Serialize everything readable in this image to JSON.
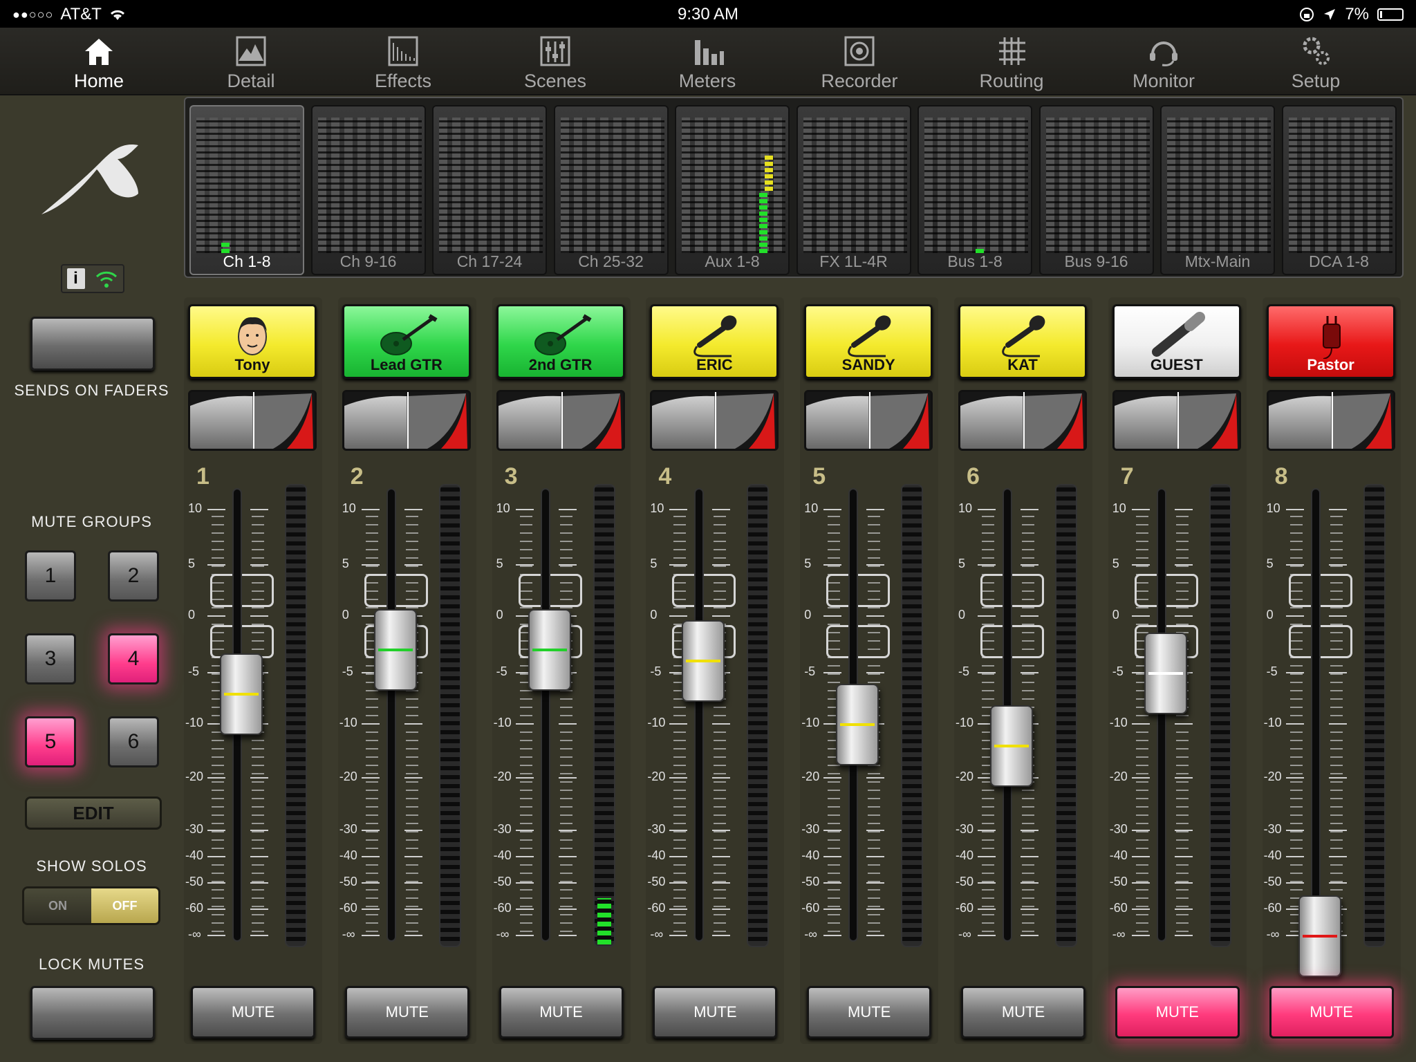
{
  "status": {
    "carrier": "AT&T",
    "time": "9:30 AM",
    "battery": "7%"
  },
  "nav": [
    {
      "label": "Home",
      "icon": "home-icon",
      "active": true
    },
    {
      "label": "Detail",
      "icon": "detail-icon"
    },
    {
      "label": "Effects",
      "icon": "effects-icon"
    },
    {
      "label": "Scenes",
      "icon": "scenes-icon"
    },
    {
      "label": "Meters",
      "icon": "meters-icon"
    },
    {
      "label": "Recorder",
      "icon": "recorder-icon"
    },
    {
      "label": "Routing",
      "icon": "routing-icon"
    },
    {
      "label": "Monitor",
      "icon": "monitor-icon"
    },
    {
      "label": "Setup",
      "icon": "setup-icon"
    }
  ],
  "left": {
    "sends_label": "SENDS ON FADERS",
    "mute_groups_label": "MUTE GROUPS",
    "mute_groups": [
      {
        "label": "1",
        "on": false
      },
      {
        "label": "2",
        "on": false
      },
      {
        "label": "3",
        "on": false
      },
      {
        "label": "4",
        "on": true
      },
      {
        "label": "5",
        "on": true
      },
      {
        "label": "6",
        "on": false
      }
    ],
    "edit_label": "EDIT",
    "show_solos_label": "SHOW SOLOS",
    "toggle_on": "ON",
    "toggle_off": "OFF",
    "lock_mutes_label": "LOCK MUTES"
  },
  "banks": [
    {
      "label": "Ch 1-8",
      "active": true
    },
    {
      "label": "Ch 9-16"
    },
    {
      "label": "Ch 17-24"
    },
    {
      "label": "Ch 25-32"
    },
    {
      "label": "Aux 1-8"
    },
    {
      "label": "FX 1L-4R"
    },
    {
      "label": "Bus 1-8"
    },
    {
      "label": "Bus 9-16"
    },
    {
      "label": "Mtx-Main"
    },
    {
      "label": "DCA 1-8"
    }
  ],
  "scale_labels": [
    "10",
    "5",
    "0",
    "-5",
    "-10",
    "-20",
    "-30",
    "-40",
    "-50",
    "-60",
    "-∞"
  ],
  "channels": [
    {
      "num": "1",
      "name": "Tony",
      "color": "yellow",
      "icon": "face-icon",
      "fader_db": "-7",
      "line": "#f0e000",
      "muted": false,
      "mute_label": "MUTE",
      "meter": 0
    },
    {
      "num": "2",
      "name": "Lead GTR",
      "color": "green",
      "icon": "guitar-icon",
      "fader_db": "-3",
      "line": "#22d02a",
      "muted": false,
      "mute_label": "MUTE",
      "meter": 0
    },
    {
      "num": "3",
      "name": "2nd GTR",
      "color": "green",
      "icon": "guitar-icon",
      "fader_db": "-3",
      "line": "#22d02a",
      "muted": false,
      "mute_label": "MUTE",
      "meter": 0.1
    },
    {
      "num": "4",
      "name": "ERIC",
      "color": "yellow",
      "icon": "microphone-icon",
      "fader_db": "-4",
      "line": "#f0e000",
      "muted": false,
      "mute_label": "MUTE",
      "meter": 0
    },
    {
      "num": "5",
      "name": "SANDY",
      "color": "yellow",
      "icon": "microphone-icon",
      "fader_db": "-10",
      "line": "#f0e000",
      "muted": false,
      "mute_label": "MUTE",
      "meter": 0
    },
    {
      "num": "6",
      "name": "KAT",
      "color": "yellow",
      "icon": "microphone-icon",
      "fader_db": "-14",
      "line": "#f0e000",
      "muted": false,
      "mute_label": "MUTE",
      "meter": 0
    },
    {
      "num": "7",
      "name": "GUEST",
      "color": "white",
      "icon": "handheld-mic-icon",
      "fader_db": "-5",
      "line": "#ffffff",
      "muted": true,
      "mute_label": "MUTE",
      "meter": 0
    },
    {
      "num": "8",
      "name": "Pastor",
      "color": "red",
      "icon": "bodypack-icon",
      "fader_db": "-∞",
      "line": "#e01818",
      "muted": true,
      "mute_label": "MUTE",
      "meter": 0
    }
  ]
}
